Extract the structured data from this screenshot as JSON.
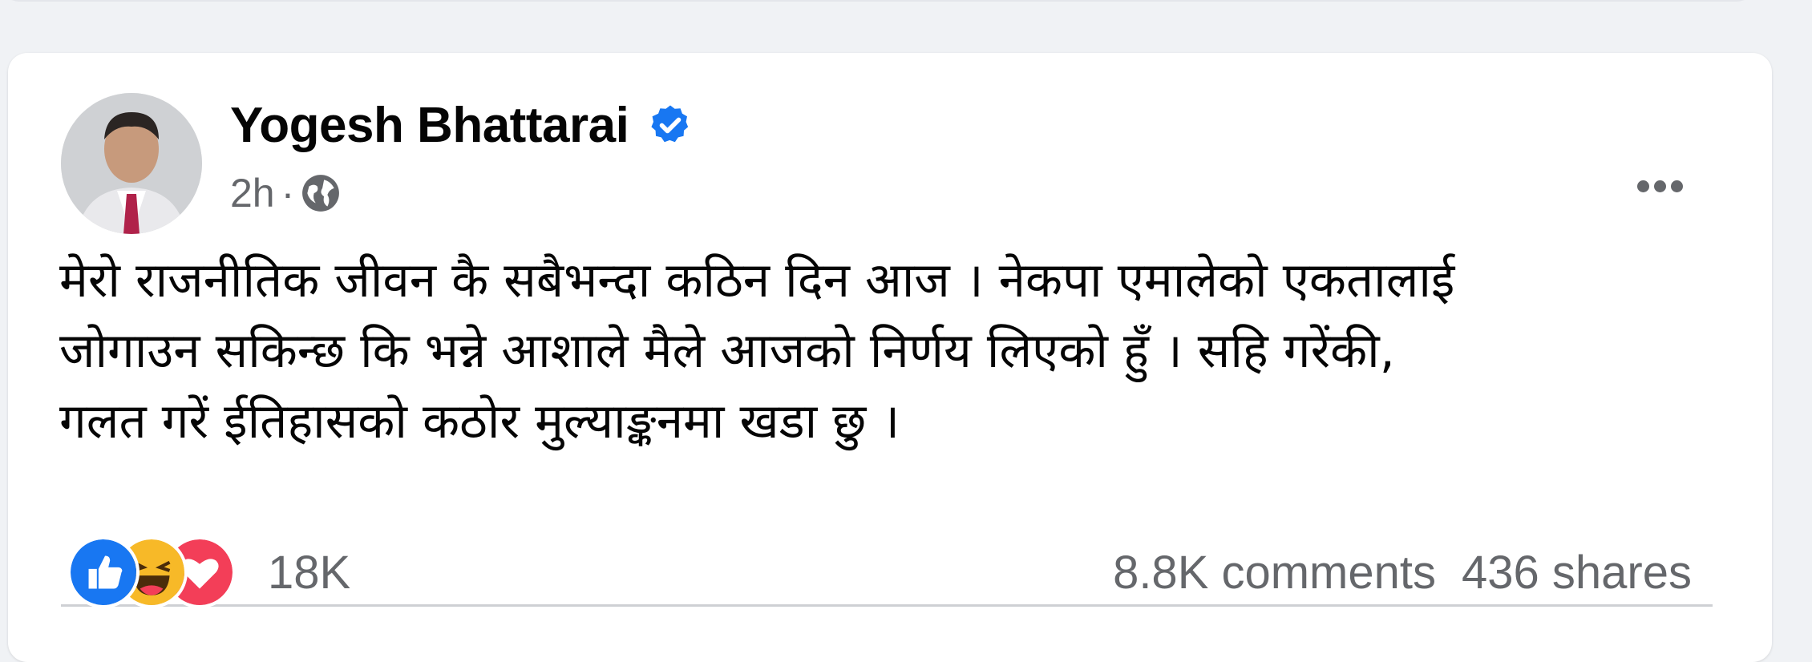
{
  "post": {
    "author": "Yogesh Bhattarai",
    "verified": true,
    "time": "2h",
    "separator": "·",
    "audience_icon": "globe-icon",
    "text": "मेरो राजनीतिक जीवन कै सबैभन्दा कठिन दिन आज । नेकपा एमालेको एकतालाई\nजोगाउन सकिन्छ कि भन्ने आशाले मैले आजको निर्णय लिएको हुँ । सहि गरेंकी,\nगलत गरें ईतिहासको कठोर मुल्याङ्कनमा खडा छु ।",
    "reactions": {
      "icons": [
        "like-reaction-icon",
        "haha-reaction-icon",
        "love-reaction-icon"
      ],
      "count": "18K"
    },
    "comments": "8.8K comments",
    "shares": "436 shares"
  },
  "colors": {
    "like": "#1877f2",
    "haha": "#f7b928",
    "love": "#f33e58",
    "verified": "#1877f2",
    "secondary_text": "#65676b"
  }
}
